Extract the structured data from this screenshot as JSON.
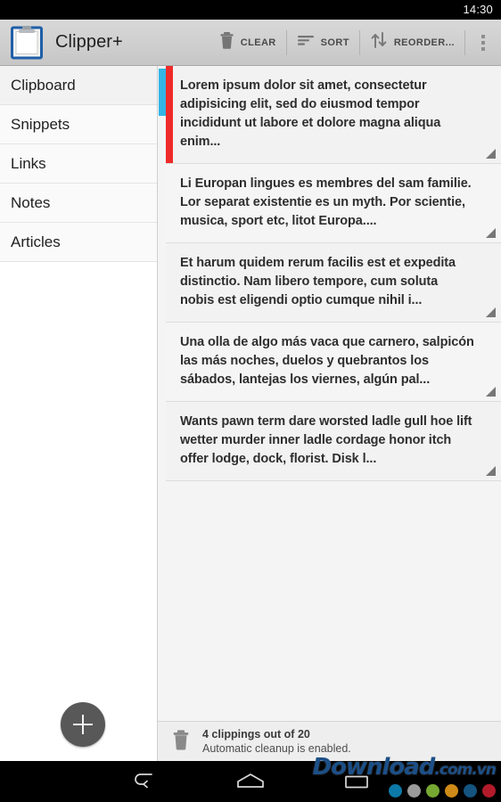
{
  "statusbar": {
    "time": "14:30"
  },
  "actionbar": {
    "app_icon": "clipboard-icon",
    "title": "Clipper+",
    "actions": [
      {
        "icon": "trash-icon",
        "label": "CLEAR"
      },
      {
        "icon": "sort-icon",
        "label": "SORT"
      },
      {
        "icon": "reorder-icon",
        "label": "REORDER..."
      }
    ],
    "overflow_icon": "overflow-menu-icon"
  },
  "sidebar": {
    "items": [
      {
        "label": "Clipboard",
        "selected": true
      },
      {
        "label": "Snippets",
        "selected": false
      },
      {
        "label": "Links",
        "selected": false
      },
      {
        "label": "Notes",
        "selected": false
      },
      {
        "label": "Articles",
        "selected": false
      }
    ],
    "fab": {
      "icon": "plus-icon",
      "label": "Add"
    }
  },
  "list": {
    "accent_color": "#ee2b29",
    "scroll_color": "#33b5e5",
    "items": [
      {
        "text": "Lorem ipsum dolor sit amet, consectetur adipisicing elit, sed do eiusmod tempor incididunt ut labore et dolore magna aliqua enim...",
        "accented": true
      },
      {
        "text": "Li Europan lingues es membres del sam familie. Lor separat existentie es un myth. Por scientie, musica, sport etc, litot Europa....",
        "accented": false
      },
      {
        "text": "Et harum quidem rerum facilis est et expedita distinctio. Nam libero tempore, cum soluta nobis est eligendi optio cumque nihil i...",
        "accented": false
      },
      {
        "text": "Una olla de algo más vaca que carnero, salpicón las más noches, duelos y quebrantos los sábados, lantejas los viernes, algún pal...",
        "accented": false
      },
      {
        "text": "Wants pawn term dare worsted ladle gull hoe lift wetter murder inner ladle cordage honor itch offer lodge, dock, florist. Disk l...",
        "accented": false
      }
    ]
  },
  "footer": {
    "icon": "trash-icon",
    "count_text": "4 clippings out of 20",
    "status_text": "Automatic cleanup is enabled."
  },
  "navbar": {
    "back": "back-icon",
    "home": "home-icon",
    "recents": "recents-icon"
  },
  "watermark": {
    "brand": "Download",
    "suffix": ".com.vn",
    "dot_colors": [
      "#0c79a8",
      "#9a9a9a",
      "#76a832",
      "#cf8b18",
      "#14547f",
      "#b31b2a"
    ]
  }
}
